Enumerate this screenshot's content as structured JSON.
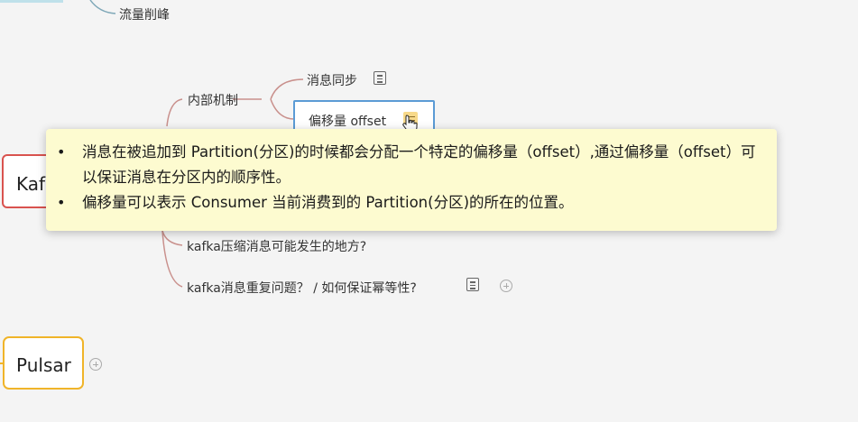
{
  "top_fragment": {
    "label": "流量削峰"
  },
  "kafka": {
    "node_label": "Kaf",
    "internal": {
      "label": "内部机制",
      "children": {
        "sync": {
          "label": "消息同步"
        },
        "offset": {
          "label": "偏移量 offset"
        }
      }
    },
    "compress": {
      "label": "kafka压缩消息可能发生的地方?"
    },
    "duplicate": {
      "label": "kafka消息重复问题？ / 如何保证幂等性?"
    }
  },
  "pulsar": {
    "node_label": "Pulsar"
  },
  "tooltip": {
    "items": [
      "消息在被追加到 Partition(分区)的时候都会分配一个特定的偏移量（offset）,通过偏移量（offset）可以保证消息在分区内的顺序性。",
      "偏移量可以表示 Consumer 当前消费到的 Partition(分区)的所在的位置。"
    ]
  },
  "colors": {
    "canvas": "#f4f4f4",
    "kafka_border": "#d9534f",
    "pulsar_border": "#f0b429",
    "selected_border": "#5b9bd5",
    "branch_line": "#c9908c",
    "tooltip_bg": "#fdfbd0"
  },
  "icons": [
    "note-icon",
    "plus-icon",
    "hand-cursor-icon"
  ]
}
